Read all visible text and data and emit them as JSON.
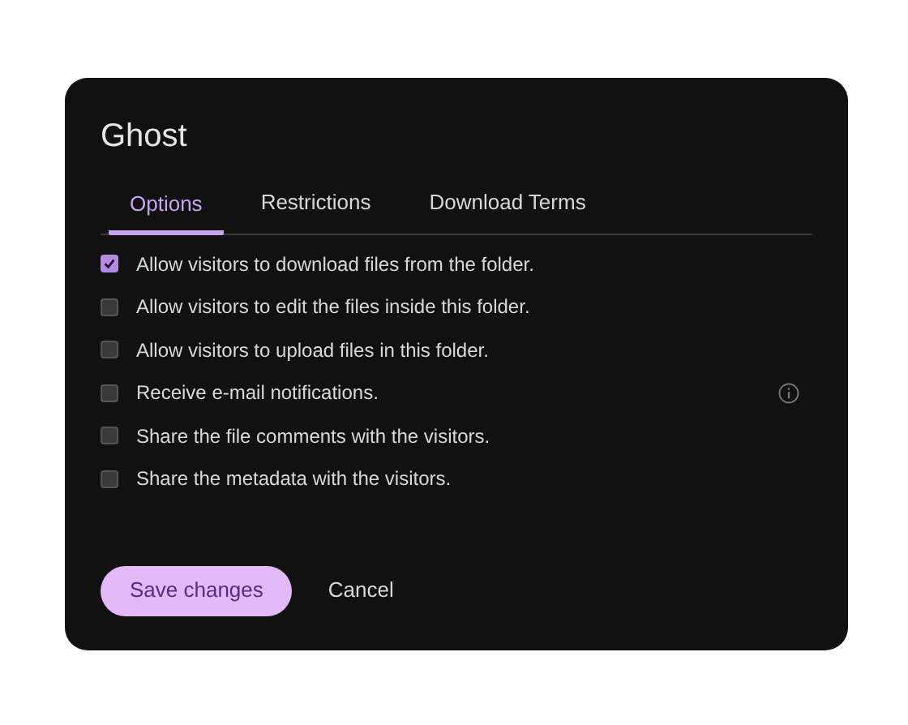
{
  "dialog": {
    "title": "Ghost"
  },
  "tabs": [
    {
      "label": "Options",
      "selected": true
    },
    {
      "label": "Restrictions",
      "selected": false
    },
    {
      "label": "Download Terms",
      "selected": false
    }
  ],
  "options": [
    {
      "label": "Allow visitors to download files from the folder.",
      "checked": true,
      "info": false
    },
    {
      "label": "Allow visitors to edit the files inside this folder.",
      "checked": false,
      "info": false
    },
    {
      "label": "Allow visitors to upload files in this folder.",
      "checked": false,
      "info": false
    },
    {
      "label": "Receive e-mail notifications.",
      "checked": false,
      "info": true
    },
    {
      "label": "Share the file comments with the visitors.",
      "checked": false,
      "info": false
    },
    {
      "label": "Share the metadata with the visitors.",
      "checked": false,
      "info": false
    }
  ],
  "buttons": {
    "primary": "Save changes",
    "secondary": "Cancel"
  }
}
